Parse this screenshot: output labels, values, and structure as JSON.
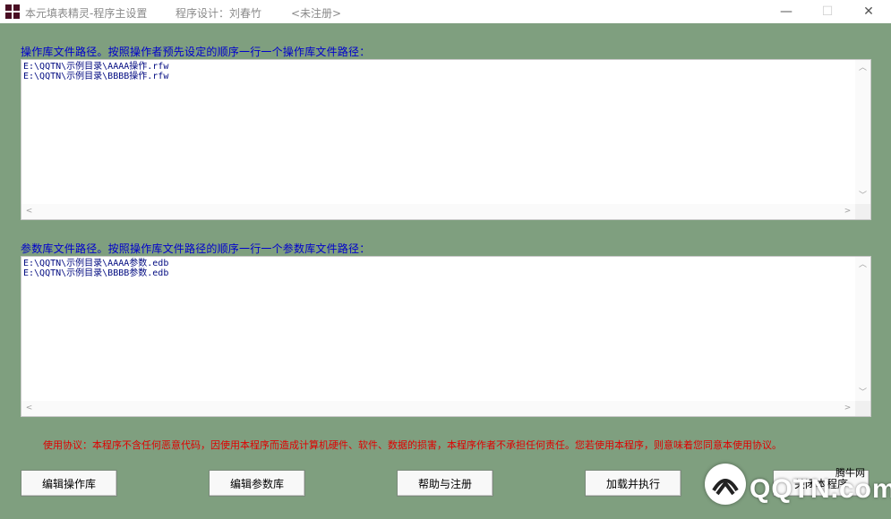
{
  "titlebar": {
    "app_title": "本元填表精灵-程序主设置",
    "designer": "程序设计：刘春竹",
    "registration": "<未注册>",
    "minimize": "—",
    "maximize": "☐",
    "close": "✕"
  },
  "operations": {
    "label": "操作库文件路径。按照操作者预先设定的顺序一行一个操作库文件路径：",
    "content": "E:\\QQTN\\示例目录\\AAAA操作.rfw\nE:\\QQTN\\示例目录\\BBBB操作.rfw"
  },
  "parameters": {
    "label": "参数库文件路径。按照操作库文件路径的顺序一行一个参数库文件路径：",
    "content": "E:\\QQTN\\示例目录\\AAAA参数.edb\nE:\\QQTN\\示例目录\\BBBB参数.edb"
  },
  "agreement": "使用协议：本程序不含任何恶意代码，因使用本程序而造成计算机硬件、软件、数据的损害，本程序作者不承担任何责任。您若使用本程序，则意味着您同意本使用协议。",
  "buttons": {
    "edit_operations": "编辑操作库",
    "edit_parameters": "编辑参数库",
    "help_register": "帮助与注册",
    "load_execute": "加载并执行",
    "close_program": "关闭本程序"
  },
  "watermark": {
    "text": "QQTN.com",
    "small": "腾牛网"
  },
  "colors": {
    "background": "#7f9f7f",
    "label_blue": "#0000cc",
    "agreement_red": "#e00000"
  }
}
